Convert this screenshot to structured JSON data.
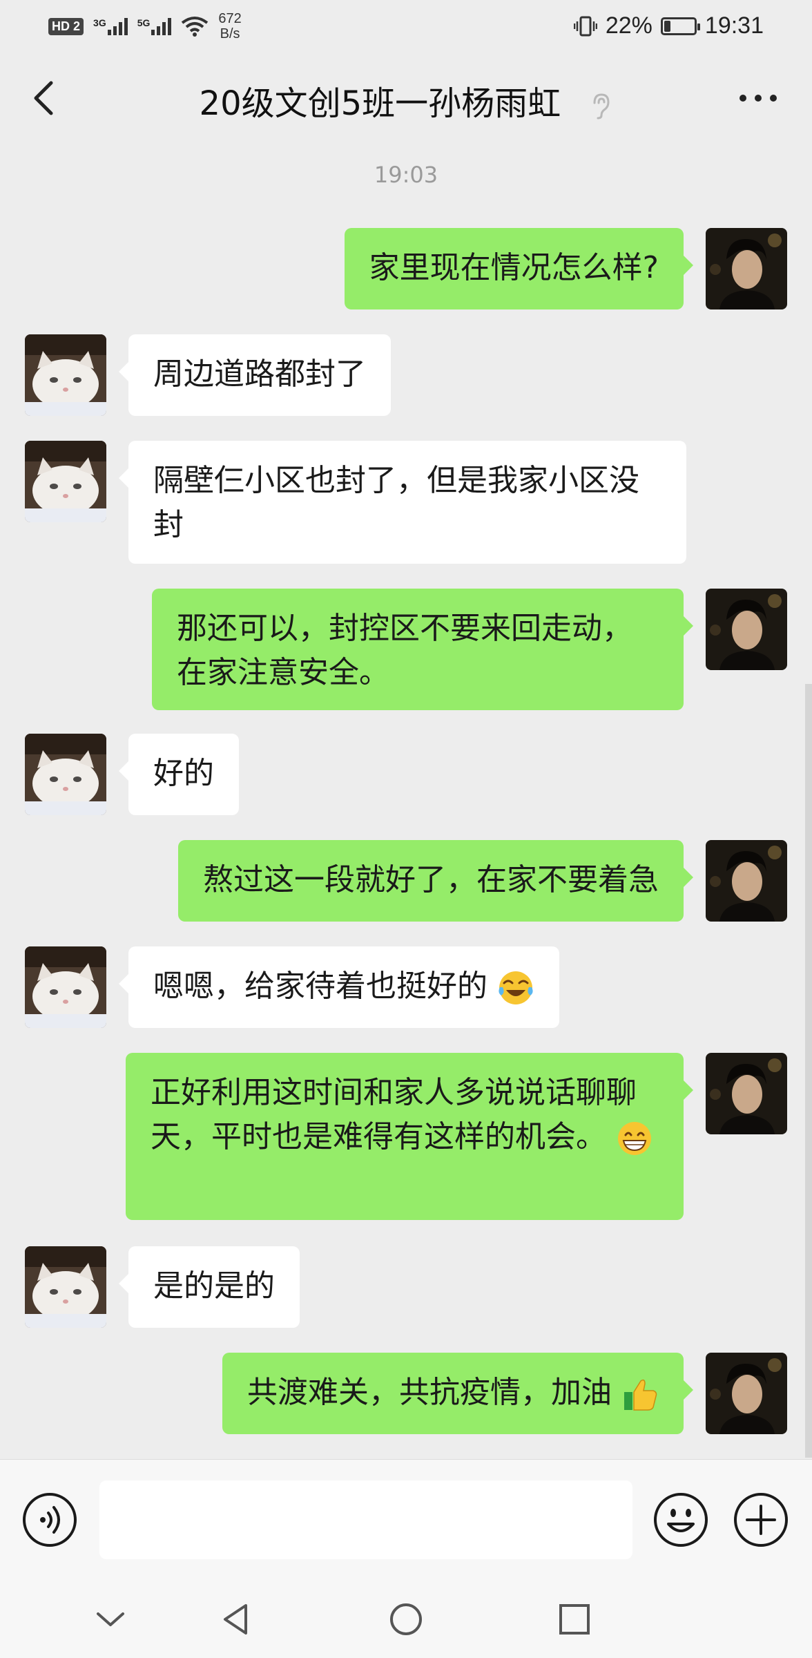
{
  "status_bar": {
    "hd": "HD",
    "sim": "2",
    "net1": "3G",
    "net2": "5G",
    "speed_value": "672",
    "speed_unit": "B/s",
    "battery_text": "22%",
    "battery_level": 0.22,
    "time": "19:31"
  },
  "header": {
    "title": "20级文创5班一孙杨雨虹"
  },
  "chat": {
    "timestamp": "19:03",
    "messages": [
      {
        "side": "out",
        "text": "家里现在情况怎么样?"
      },
      {
        "side": "in",
        "text": "周边道路都封了"
      },
      {
        "side": "in",
        "text": "隔壁仨小区也封了，但是我家小区没封"
      },
      {
        "side": "out",
        "text": "那还可以，封控区不要来回走动，在家注意安全。"
      },
      {
        "side": "in",
        "text": "好的"
      },
      {
        "side": "out",
        "text": "熬过这一段就好了，在家不要着急"
      },
      {
        "side": "in",
        "text": "嗯嗯，给家待着也挺好的",
        "emoji": "laugh-cry-emoji"
      },
      {
        "side": "out",
        "text": "正好利用这时间和家人多说说话聊聊天，平时也是难得有这样的机会。",
        "emoji": "grin-emoji"
      },
      {
        "side": "in",
        "text": "是的是的"
      },
      {
        "side": "out",
        "text": "共渡难关，共抗疫情，加油",
        "emoji": "thumbs-up-emoji"
      }
    ]
  },
  "colors": {
    "out_bubble": "#95ec69",
    "in_bubble": "#ffffff",
    "background": "#ededed"
  },
  "input_bar": {
    "voice_icon": "voice-icon",
    "emoji_icon": "emoji-icon",
    "plus_icon": "plus-icon",
    "value": ""
  },
  "nav_bar": {
    "icons": [
      "chevron-down-icon",
      "back-triangle-icon",
      "home-circle-icon",
      "recents-square-icon"
    ]
  }
}
